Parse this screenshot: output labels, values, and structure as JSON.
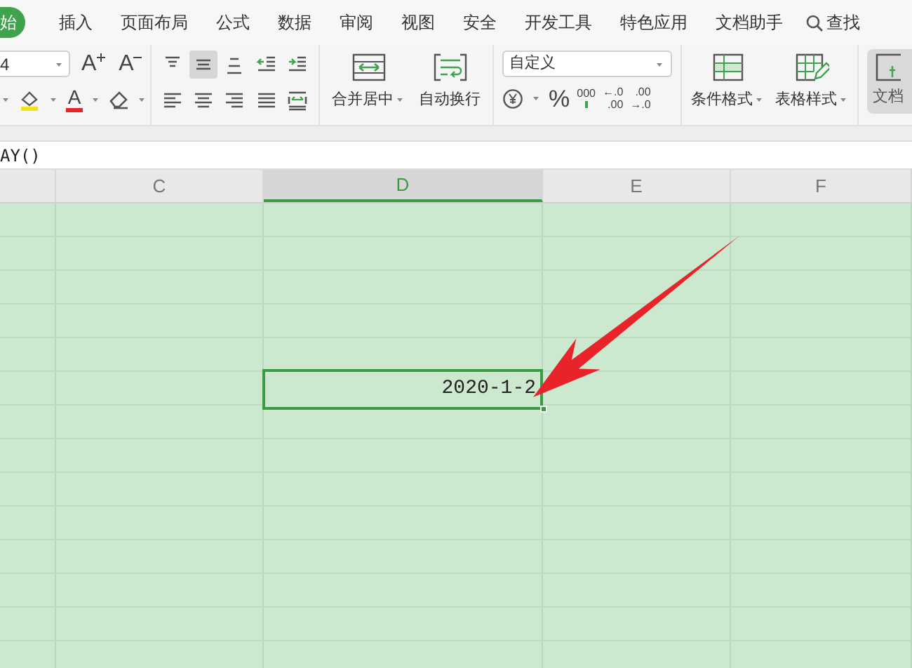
{
  "menu_tabs": [
    {
      "label": "始",
      "selected": true
    },
    {
      "label": "插入",
      "selected": false
    },
    {
      "label": "页面布局",
      "selected": false
    },
    {
      "label": "公式",
      "selected": false
    },
    {
      "label": "数据",
      "selected": false
    },
    {
      "label": "审阅",
      "selected": false
    },
    {
      "label": "视图",
      "selected": false
    },
    {
      "label": "安全",
      "selected": false
    },
    {
      "label": "开发工具",
      "selected": false
    },
    {
      "label": "特色应用",
      "selected": false
    },
    {
      "label": "文档助手",
      "selected": false
    }
  ],
  "search": {
    "label": "查找"
  },
  "font": {
    "size": "4",
    "grow_label": "A",
    "shrink_label": "A",
    "color_label": "A"
  },
  "alignment": {
    "buttons": [
      {
        "kind": "top",
        "selected": false
      },
      {
        "kind": "middle",
        "selected": true
      },
      {
        "kind": "bottom",
        "selected": false
      },
      {
        "kind": "outdent",
        "selected": false
      },
      {
        "kind": "indent",
        "selected": false
      },
      {
        "kind": "left",
        "selected": false
      },
      {
        "kind": "center",
        "selected": false
      },
      {
        "kind": "right",
        "selected": false
      },
      {
        "kind": "justify",
        "selected": false
      },
      {
        "kind": "distributed",
        "selected": false
      }
    ]
  },
  "merge_buttons": [
    {
      "kind": "merge",
      "label": "合并居中",
      "dropdown": true
    },
    {
      "kind": "wrap",
      "label": "自动换行",
      "dropdown": false
    }
  ],
  "number": {
    "format": "自定义",
    "percent": "%",
    "thousands": "000",
    "increase_decimal": [
      "←.0",
      ".00"
    ],
    "decrease_decimal": [
      ".00",
      "→.0"
    ]
  },
  "style_buttons": [
    {
      "kind": "conditional",
      "label": "条件格式"
    },
    {
      "kind": "table",
      "label": "表格样式"
    }
  ],
  "assistant_button": {
    "label": "文档"
  },
  "formula_bar": {
    "value": "AY()"
  },
  "columns": [
    {
      "selected": false
    },
    {
      "label": "C",
      "selected": false
    },
    {
      "label": "D",
      "selected": true
    },
    {
      "label": "E",
      "selected": false
    },
    {
      "label": "F",
      "selected": false
    }
  ],
  "active_cell": {
    "value": "2020-1-2"
  }
}
